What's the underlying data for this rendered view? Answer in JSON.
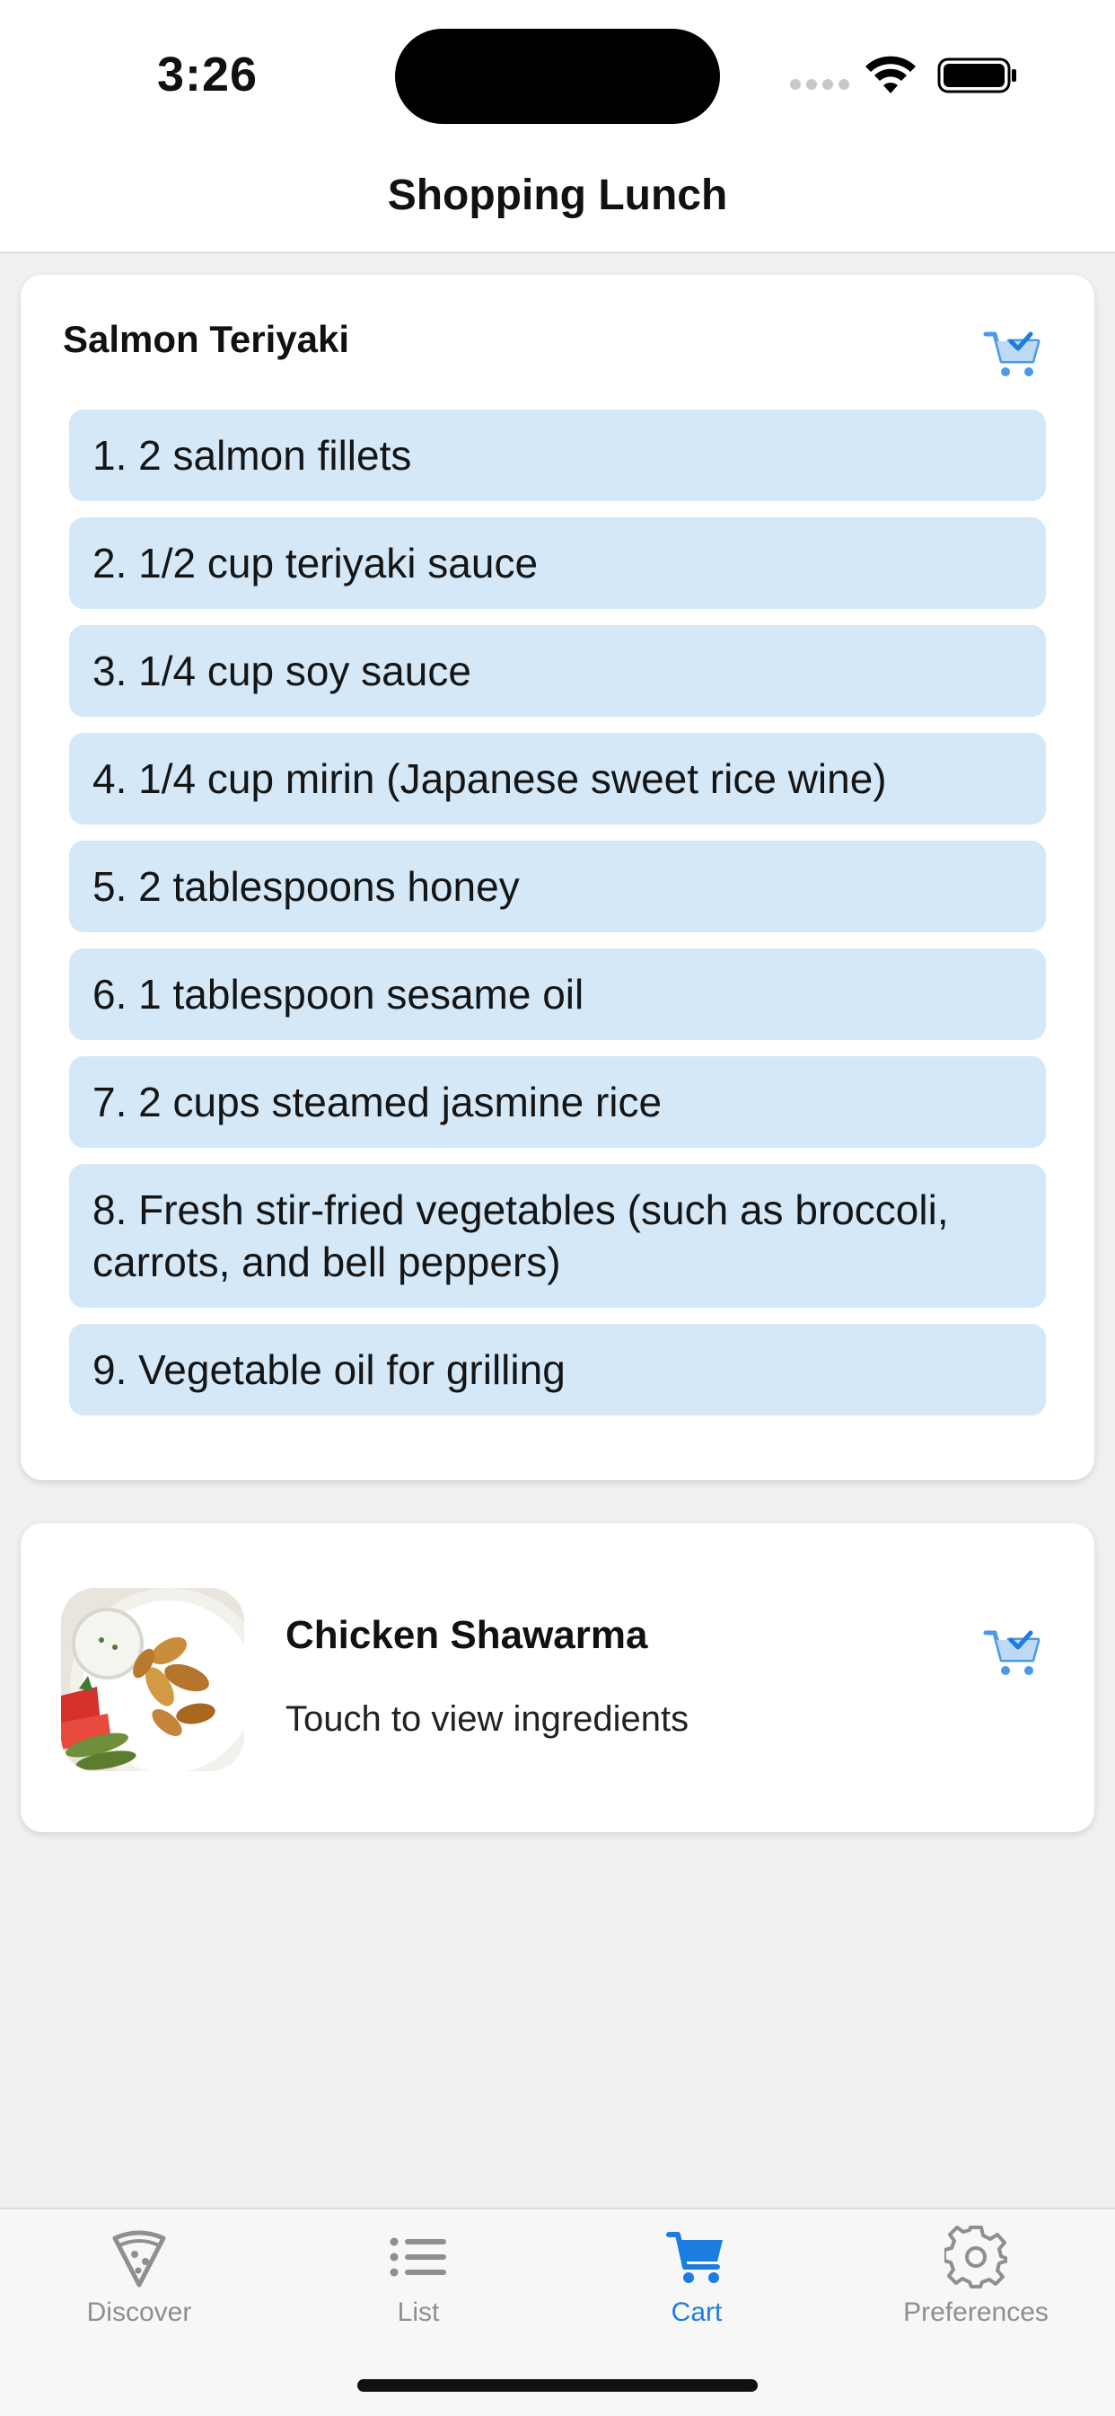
{
  "status_bar": {
    "time": "3:26",
    "icons": [
      "signal-icon",
      "wifi-icon",
      "battery-icon"
    ]
  },
  "header": {
    "title": "Shopping Lunch"
  },
  "recipes": [
    {
      "name": "Salmon Teriyaki",
      "cart_icon": "cart-check-icon",
      "ingredients": [
        "1. 2 salmon fillets",
        "2. 1/2 cup teriyaki sauce",
        "3. 1/4 cup soy sauce",
        "4. 1/4 cup mirin (Japanese sweet rice wine)",
        "5. 2 tablespoons honey",
        "6. 1 tablespoon sesame oil",
        "7. 2 cups steamed jasmine rice",
        "8. Fresh stir-fried vegetables (such as broccoli, carrots, and bell peppers)",
        "9. Vegetable oil for grilling"
      ]
    },
    {
      "name": "Chicken Shawarma",
      "subtitle": "Touch to view ingredients",
      "cart_icon": "cart-check-icon",
      "thumbnail": "chicken-shawarma-photo"
    }
  ],
  "tabs": [
    {
      "label": "Discover",
      "icon": "pizza-slice-icon",
      "active": false
    },
    {
      "label": "List",
      "icon": "list-icon",
      "active": false
    },
    {
      "label": "Cart",
      "icon": "cart-icon",
      "active": true
    },
    {
      "label": "Preferences",
      "icon": "gear-icon",
      "active": false
    }
  ],
  "colors": {
    "accent": "#1c7de0",
    "ingredient_bg": "#d4e8f7",
    "inactive_tab": "#8e8e93",
    "page_bg": "#f0f0f0"
  }
}
